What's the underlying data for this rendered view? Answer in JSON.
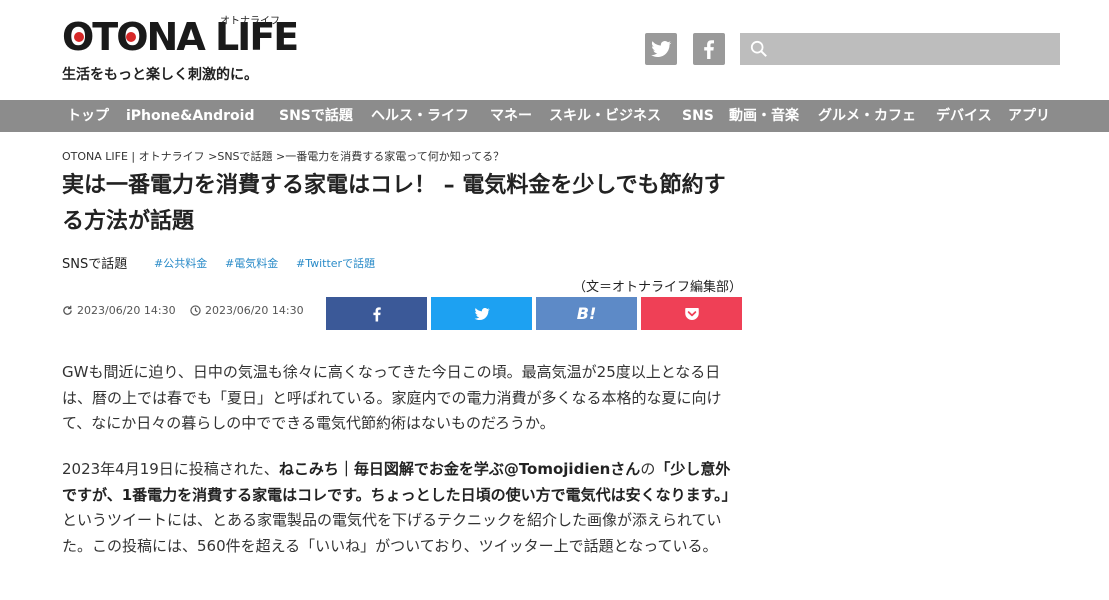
{
  "header": {
    "logo_text": "OTONA LIFE",
    "logo_kana": "オトナライフ",
    "tagline": "生活をもっと楽しく刺激的に。",
    "search_placeholder": ""
  },
  "nav": {
    "items": [
      "トップ",
      "iPhone&Android",
      "SNSで話題",
      "ヘルス・ライフ",
      "マネー",
      "スキル・ビジネス",
      "SNS",
      "動画・音楽",
      "グルメ・カフェ",
      "デバイス",
      "アプリ"
    ]
  },
  "article": {
    "breadcrumb": "OTONA LIFE | オトナライフ >SNSで話題 >一番電力を消費する家電って何か知ってる？",
    "title": "実は一番電力を消費する家電はコレ！ – 電気料金を少しでも節約する方法が話題",
    "category": "SNSで話題",
    "tags": [
      "#公共料金",
      "#電気料金",
      "#Twitterで話題"
    ],
    "byline": "（文＝オトナライフ編集部）",
    "updated": "2023/06/20 14:30",
    "published": "2023/06/20 14:30",
    "hatena_label": "B!",
    "para1": "GWも間近に迫り、日中の気温も徐々に高くなってきた今日この頃。最高気温が25度以上となる日は、暦の上では春でも「夏日」と呼ばれている。家庭内での電力消費が多くなる本格的な夏に向けて、なにか日々の暮らしの中でできる電気代節約術はないものだろうか。",
    "para2_a": "2023年4月19日に投稿された、",
    "para2_author": "ねこみち｜毎日図解でお金を学ぶ@Tomojidienさん",
    "para2_b": "の",
    "para2_quote": "「少し意外ですが、1番電力を消費する家電はコレです。ちょっとした日頃の使い方で電気代は安くなります。」",
    "para2_c": "というツイートには、とある家電製品の電気代を下げるテクニックを紹介した画像が添えられていた。この投稿には、560件を超える「いいね」がついており、ツイッター上で話題となっている。"
  },
  "colors": {
    "nav_bg": "#8c8c8c",
    "facebook": "#3b5998",
    "twitter": "#1da1f2",
    "hatena": "#5d8ac7",
    "pocket": "#ef4056",
    "tag": "#2a8bc8"
  }
}
